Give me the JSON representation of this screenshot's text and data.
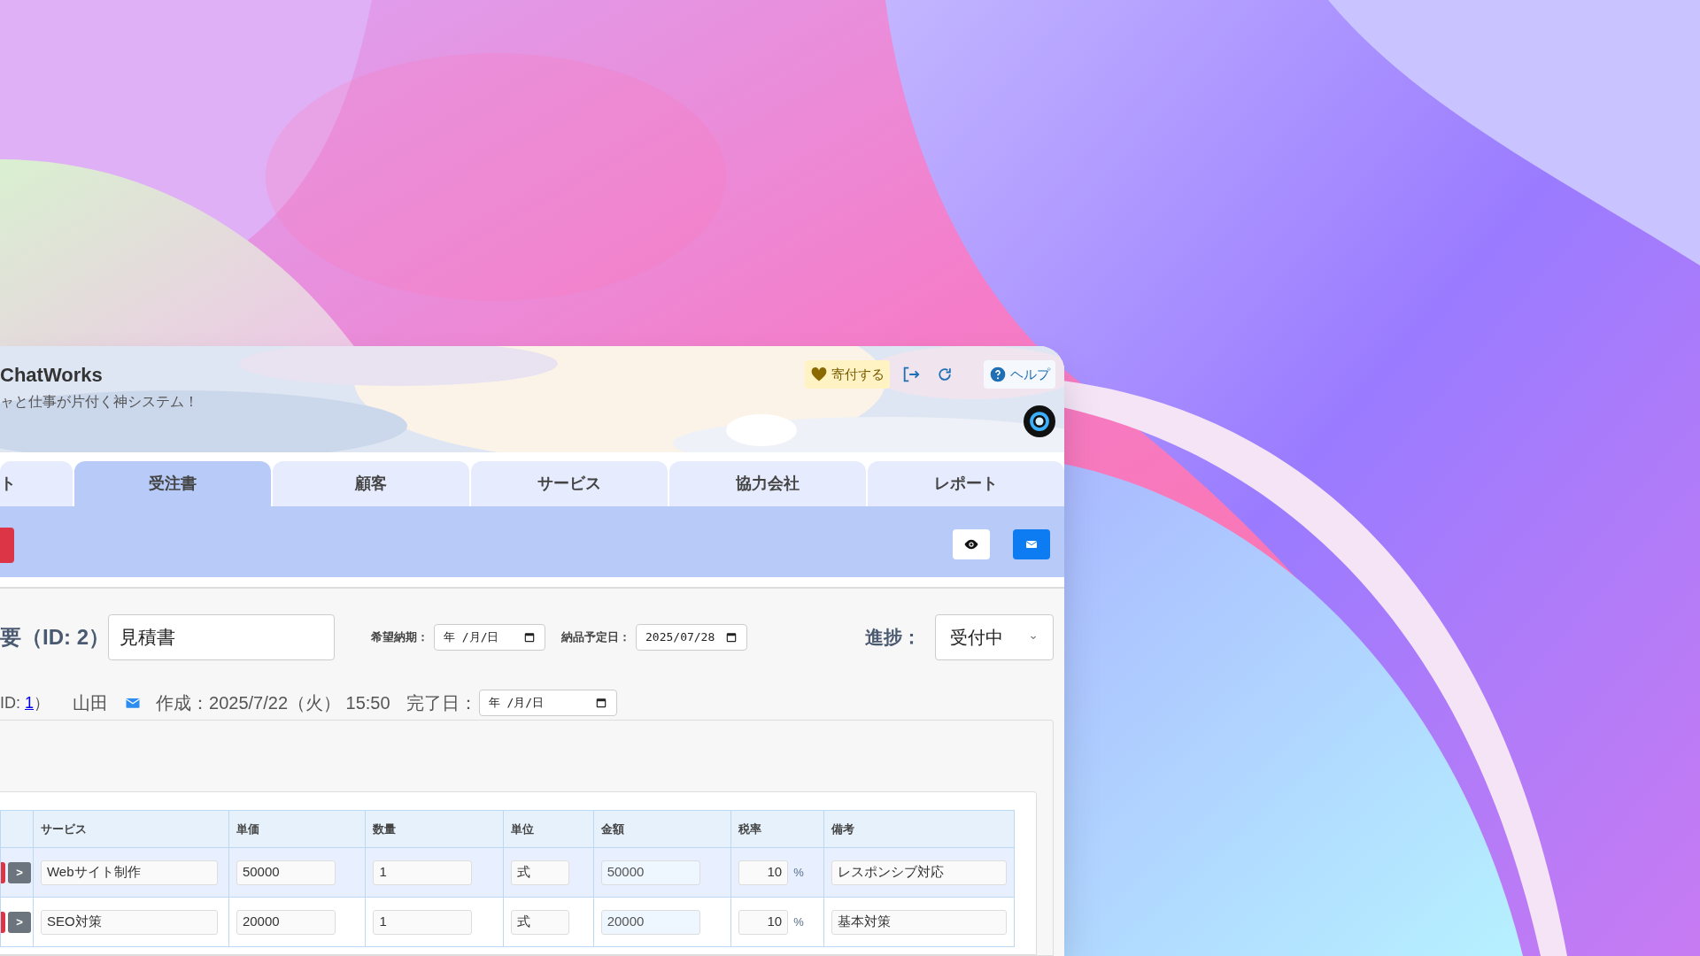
{
  "app": {
    "title": "ChatWorks",
    "tagline": "ャと仕事が片付く神システム！"
  },
  "header_actions": {
    "donate": "寄付する",
    "help": "ヘルプ"
  },
  "tabs": [
    {
      "label": "ト",
      "selected": false
    },
    {
      "label": "受注書",
      "selected": true
    },
    {
      "label": "顧客",
      "selected": false
    },
    {
      "label": "サービス",
      "selected": false
    },
    {
      "label": "協力会社",
      "selected": false
    },
    {
      "label": "レポート",
      "selected": false
    }
  ],
  "form": {
    "heading": "要（ID: 2）",
    "title_value": "見積書",
    "desired_label": "希望納期：",
    "desired_value": "年 /月/日",
    "delivery_label": "納品予定日：",
    "delivery_value": "2025/07/28",
    "progress_label": "進捗：",
    "progress_value": "受付中"
  },
  "meta": {
    "id_prefix": "ID: ",
    "id_link": "1",
    "id_suffix": "）",
    "person": "山田",
    "created": "作成：2025/7/22（火） 15:50",
    "completed_label": "完了日：",
    "completed_value": "年 /月/日"
  },
  "table": {
    "columns": [
      "サービス",
      "単価",
      "数量",
      "単位",
      "金額",
      "税率",
      "備考"
    ],
    "rows": [
      {
        "move": ">",
        "service": "Webサイト制作",
        "price": "50000",
        "qty": "1",
        "unit": "式",
        "amount": "50000",
        "tax": "10",
        "tax_unit": "%",
        "note": "レスポンシブ対応"
      },
      {
        "move": ">",
        "service": "SEO対策",
        "price": "20000",
        "qty": "1",
        "unit": "式",
        "amount": "20000",
        "tax": "10",
        "tax_unit": "%",
        "note": "基本対策"
      }
    ]
  }
}
